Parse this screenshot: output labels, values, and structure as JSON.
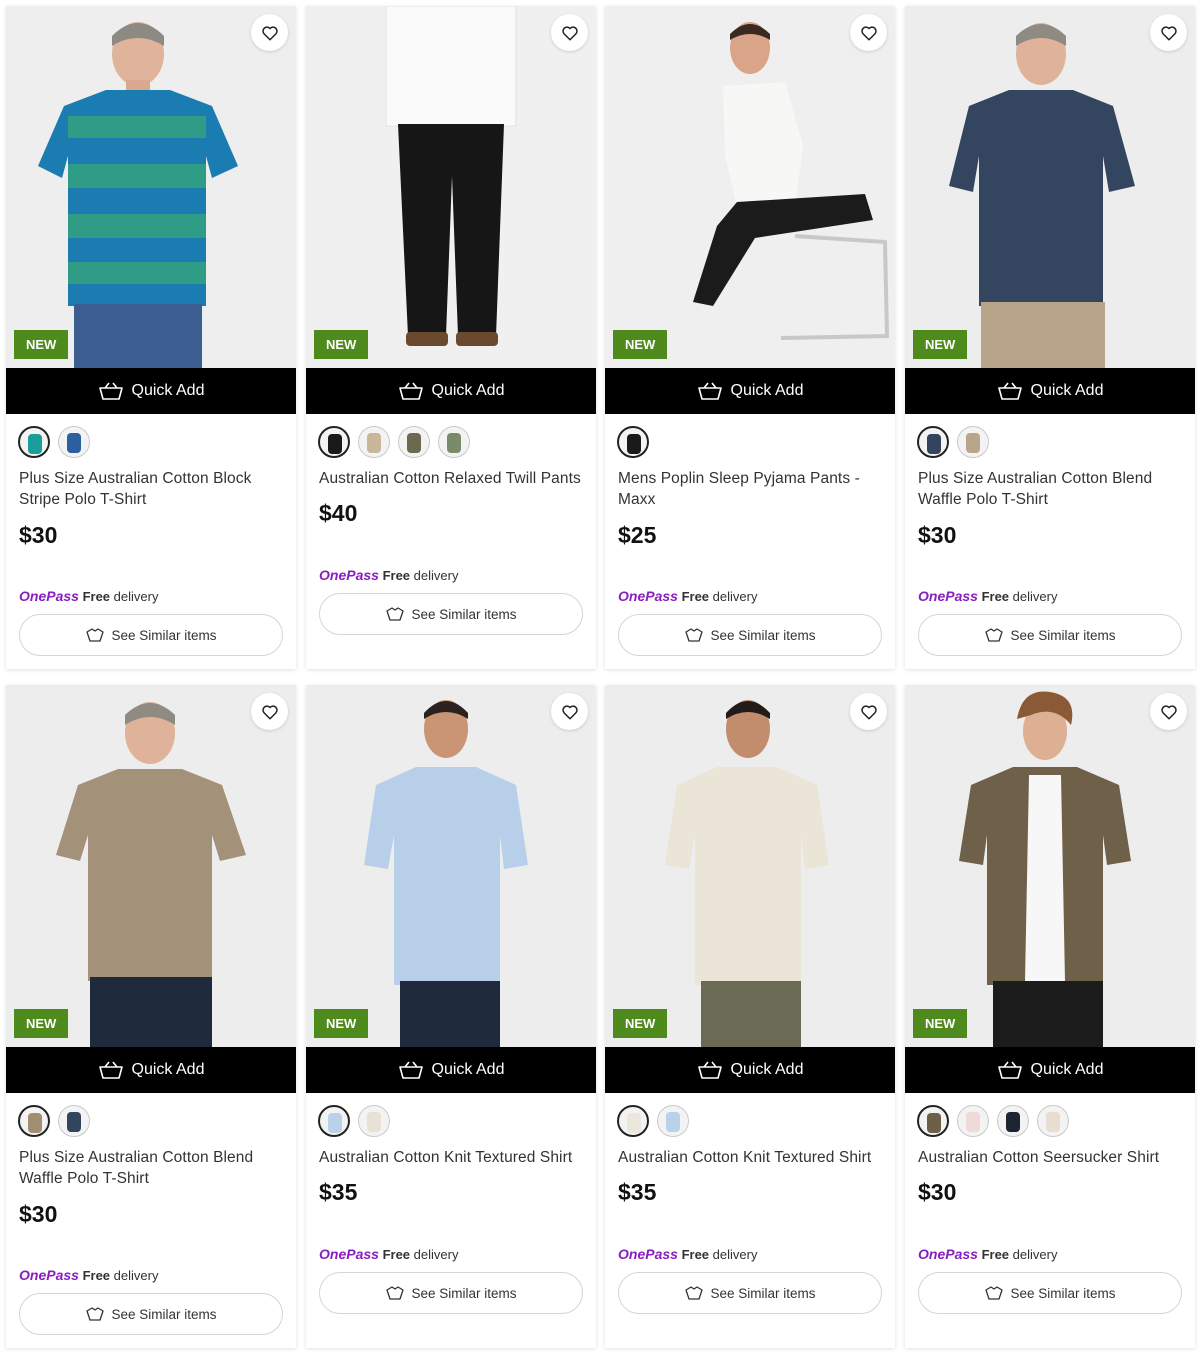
{
  "colors": {
    "new_badge": "#4f8a1c",
    "onepass_brand": "#8a1dbf",
    "quick_add_bg": "#000000"
  },
  "quick_add_label": "Quick Add",
  "see_similar_label": "See Similar items",
  "onepass": {
    "brand": "OnePass",
    "free": "Free",
    "delivery": "delivery"
  },
  "products": [
    {
      "title": "Plus Size Australian Cotton Block Stripe Polo T-Shirt",
      "price": "$30",
      "badge": "NEW",
      "swatches": [
        "#1a9e9a",
        "#2b5fa0"
      ]
    },
    {
      "title": "Australian Cotton Relaxed Twill Pants",
      "price": "$40",
      "badge": "NEW",
      "swatches": [
        "#1a1a1a",
        "#c8b79a",
        "#6b6a4f",
        "#7a8a6b"
      ]
    },
    {
      "title": "Mens Poplin Sleep Pyjama Pants - Maxx",
      "price": "$25",
      "badge": "NEW",
      "swatches": [
        "#1a1a1a"
      ]
    },
    {
      "title": "Plus Size Australian Cotton Blend Waffle Polo T-Shirt",
      "price": "$30",
      "badge": "NEW",
      "swatches": [
        "#33455e",
        "#b7a58c"
      ]
    },
    {
      "title": "Plus Size Australian Cotton Blend Waffle Polo T-Shirt",
      "price": "$30",
      "badge": "NEW",
      "swatches": [
        "#a08e72",
        "#33455e"
      ]
    },
    {
      "title": "Australian Cotton Knit Textured Shirt",
      "price": "$35",
      "badge": "NEW",
      "swatches": [
        "#b9d2ea",
        "#e9e2d4"
      ]
    },
    {
      "title": "Australian Cotton Knit Textured Shirt",
      "price": "$35",
      "badge": "NEW",
      "swatches": [
        "#ece7dc",
        "#b9d2ea"
      ]
    },
    {
      "title": "Australian Cotton Seersucker Shirt",
      "price": "$30",
      "badge": "NEW",
      "swatches": [
        "#6d6049",
        "#f0d9d9",
        "#1d2433",
        "#e8ddd0"
      ]
    }
  ]
}
